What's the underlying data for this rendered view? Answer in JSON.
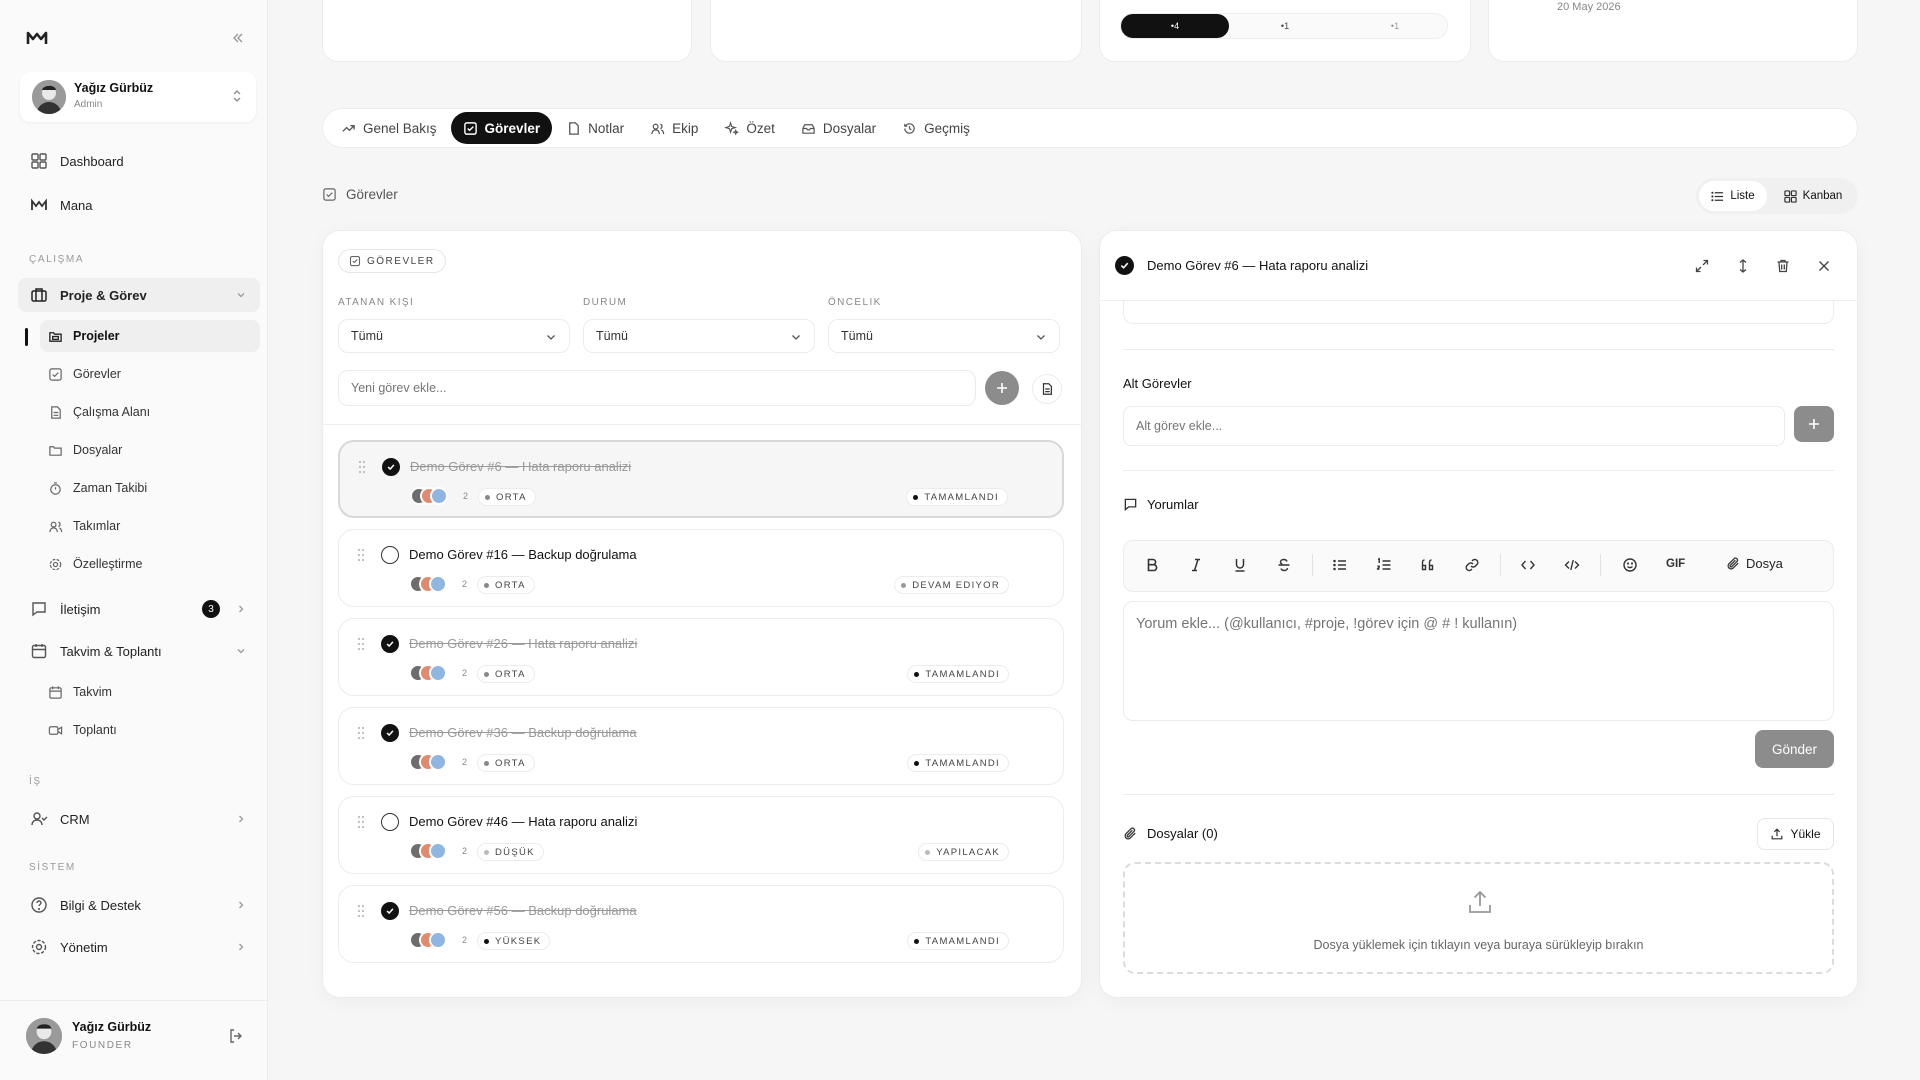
{
  "user": {
    "name": "Yağız Gürbüz",
    "role": "Admin"
  },
  "sidebar": {
    "dashboard": "Dashboard",
    "mana": "Mana",
    "section_work": "ÇALIŞMA",
    "proje_gorev": "Proje & Görev",
    "sub": [
      "Projeler",
      "Görevler",
      "Çalışma Alanı",
      "Dosyalar",
      "Zaman Takibi",
      "Takımlar",
      "Özelleştirme"
    ],
    "iletisim": "İletişim",
    "iletisim_badge": "3",
    "takvim_toplanti": "Takvim & Toplantı",
    "takvim_sub": [
      "Takvim",
      "Toplantı"
    ],
    "section_is": "İŞ",
    "crm": "CRM",
    "section_sistem": "SİSTEM",
    "bilgi": "Bilgi & Destek",
    "yonetim": "Yönetim"
  },
  "footer_user": {
    "name": "Yağız Gürbüz",
    "role": "FOUNDER"
  },
  "top_cards": {
    "segments": [
      "4",
      "1",
      "1"
    ],
    "date": "20 May 2026"
  },
  "tabs": [
    "Genel Bakış",
    "Görevler",
    "Notlar",
    "Ekip",
    "Özet",
    "Dosyalar",
    "Geçmiş"
  ],
  "page_heading": "Görevler",
  "view_toggle": {
    "list": "Liste",
    "kanban": "Kanban"
  },
  "tasks_panel": {
    "badge": "GÖREVLER",
    "filters": [
      {
        "label": "ATANAN KIŞI",
        "value": "Tümü"
      },
      {
        "label": "DURUM",
        "value": "Tümü"
      },
      {
        "label": "ÖNCELIK",
        "value": "Tümü"
      }
    ],
    "new_task_placeholder": "Yeni görev ekle...",
    "tasks": [
      {
        "title": "Demo Görev #6 — Hata raporu analizi",
        "done": true,
        "count": "2",
        "priority": "ORTA",
        "status": "TAMAMLANDI"
      },
      {
        "title": "Demo Görev #16 — Backup doğrulama",
        "done": false,
        "count": "2",
        "priority": "ORTA",
        "status": "DEVAM EDIYOR"
      },
      {
        "title": "Demo Görev #26 — Hata raporu analizi",
        "done": true,
        "count": "2",
        "priority": "ORTA",
        "status": "TAMAMLANDI"
      },
      {
        "title": "Demo Görev #36 — Backup doğrulama",
        "done": true,
        "count": "2",
        "priority": "ORTA",
        "status": "TAMAMLANDI"
      },
      {
        "title": "Demo Görev #46 — Hata raporu analizi",
        "done": false,
        "count": "2",
        "priority": "DÜŞÜK",
        "status": "YAPILACAK"
      },
      {
        "title": "Demo Görev #56 — Backup doğrulama",
        "done": true,
        "count": "2",
        "priority": "YÜKSEK",
        "status": "TAMAMLANDI"
      }
    ]
  },
  "detail": {
    "title": "Demo Görev #6 — Hata raporu analizi",
    "subtasks_heading": "Alt Görevler",
    "subtask_placeholder": "Alt görev ekle...",
    "comments_heading": "Yorumlar",
    "toolbar_gif": "GIF",
    "toolbar_file": "Dosya",
    "comment_placeholder": "Yorum ekle... (@kullanıcı, #proje, !görev için @ # ! kullanın)",
    "send": "Gönder",
    "files_heading": "Dosyalar (0)",
    "upload": "Yükle",
    "dropzone": "Dosya yüklemek için tıklayın veya buraya sürükleyip bırakın"
  }
}
